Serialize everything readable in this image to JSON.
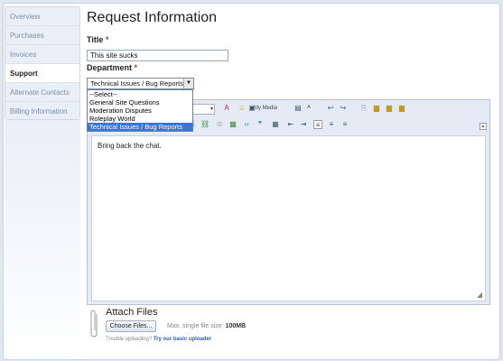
{
  "sidebar": {
    "items": [
      {
        "label": "Overview"
      },
      {
        "label": "Purchases"
      },
      {
        "label": "Invoices"
      },
      {
        "label": "Support"
      },
      {
        "label": "Alternate Contacts"
      },
      {
        "label": "Billing Information"
      }
    ]
  },
  "page": {
    "heading": "Request Information",
    "title_label": "Title",
    "title_value": "This site sucks",
    "department_label": "Department",
    "required_mark": "*"
  },
  "department": {
    "selected": "Technical Issues / Bug Reports",
    "options": [
      {
        "label": "--Select--"
      },
      {
        "label": "General Site Questions"
      },
      {
        "label": "Moderation Disputes"
      },
      {
        "label": "Roleplay World"
      },
      {
        "label": "Technical Issues / Bug Reports"
      }
    ]
  },
  "editor": {
    "my_media_label": "My Media",
    "body_text": "Bring back the chat."
  },
  "attach": {
    "title": "Attach Files",
    "choose_button": "Choose Files...",
    "max_size_prefix": "Max. single file size:",
    "max_size_value": "100MB",
    "trouble_text": "Trouble uploading?",
    "basic_uploader_link": "Try our basic uploader"
  },
  "colors": {
    "accent": "#3875d7",
    "required": "#c0302a",
    "link": "#2a5db0"
  }
}
